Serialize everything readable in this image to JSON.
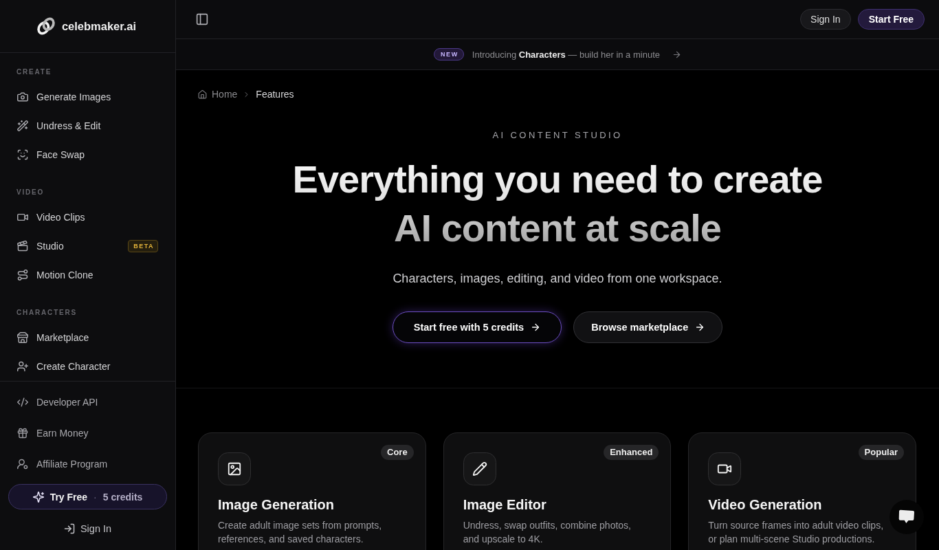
{
  "sidebar": {
    "logo": {
      "text": "celebmaker.ai"
    },
    "sections": [
      {
        "title": "CREATE",
        "items": [
          {
            "label": "Generate Images",
            "selected": false
          },
          {
            "label": "Undress & Edit",
            "selected": false
          },
          {
            "label": "Face Swap",
            "selected": false
          }
        ]
      },
      {
        "title": "VIDEO",
        "items": [
          {
            "label": "Video Clips",
            "selected": false
          },
          {
            "label": "Studio",
            "badge": "BETA",
            "selected": false
          },
          {
            "label": "Motion Clone",
            "selected": false
          }
        ]
      },
      {
        "title": "CHARACTERS",
        "items": [
          {
            "label": "Marketplace",
            "selected": false
          },
          {
            "label": "Create Character",
            "selected": false
          }
        ]
      }
    ],
    "footer_links": [
      {
        "label": "Developer API"
      },
      {
        "label": "Earn Money"
      },
      {
        "label": "Affiliate Program"
      }
    ],
    "try_free": {
      "label": "Try Free",
      "separator": "·",
      "credits": "5 credits"
    },
    "sign_in": {
      "label": "Sign In"
    }
  },
  "header": {
    "buttons": [
      {
        "label": "Sign In",
        "kind": "secondary"
      },
      {
        "label": "Start Free",
        "kind": "primary"
      }
    ]
  },
  "announcement": {
    "badge": "NEW",
    "text": "Introducing **Characters** — build her in a minute"
  },
  "breadcrumb": [
    {
      "label": "Home"
    },
    {
      "label": "Features"
    }
  ],
  "hero": {
    "eyebrow": "AI CONTENT STUDIO",
    "title_lines": [
      "Everything you need to create",
      "AI content at scale"
    ],
    "subtitle": "Characters, images, editing, and video from one workspace.",
    "buttons": [
      {
        "label": "Start free with 5 credits",
        "kind": "primary"
      },
      {
        "label": "Browse marketplace",
        "kind": "secondary"
      }
    ]
  },
  "features": [
    {
      "badge": "Core",
      "title": "Image Generation",
      "description": "Create adult image sets from prompts, references, and saved characters."
    },
    {
      "badge": "Enhanced",
      "title": "Image Editor",
      "description": "Undress, swap outfits, combine photos, and upscale to 4K."
    },
    {
      "badge": "Popular",
      "title": "Video Generation",
      "description": "Turn source frames into adult video clips, or plan multi-scene Studio productions."
    }
  ]
}
